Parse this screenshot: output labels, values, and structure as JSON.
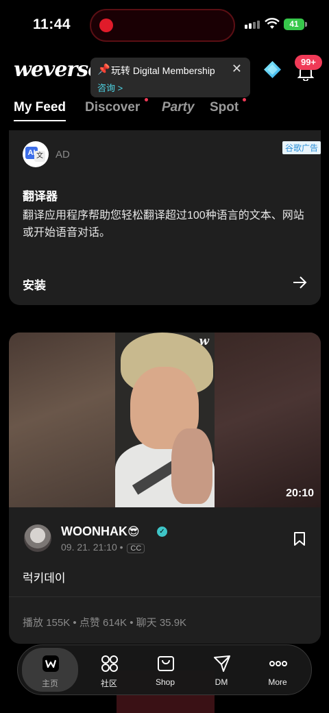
{
  "status_bar": {
    "time": "11:44",
    "battery": "41"
  },
  "header": {
    "logo": "weverse",
    "popup": {
      "text": "玩转 Digital Membership",
      "link": "咨询 >"
    },
    "notification_badge": "99+"
  },
  "tabs": [
    {
      "label": "My Feed"
    },
    {
      "label": "Discover"
    },
    {
      "label": "Party"
    },
    {
      "label": "Spot"
    }
  ],
  "ad": {
    "label": "AD",
    "google_tag": "谷歌广告",
    "icon_text_a": "AI",
    "icon_text_b": "文",
    "title": "翻译器",
    "description": "翻译应用程序帮助您轻松翻译超过100种语言的文本、网站或开始语音对话。",
    "install": "安装"
  },
  "post": {
    "duration": "20:10",
    "watermark": "w",
    "author": "WOONHAK",
    "author_emoji": "😎",
    "date": "09. 21. 21:10 •",
    "cc": "CC",
    "text": "럭키데이",
    "stats": {
      "plays_label": "播放",
      "plays": "155K",
      "likes_label": "点赞",
      "likes": "614K",
      "chats_label": "聊天",
      "chats": "35.9K"
    }
  },
  "nav": [
    {
      "label": "主页"
    },
    {
      "label": "社区"
    },
    {
      "label": "Shop"
    },
    {
      "label": "DM"
    },
    {
      "label": "More"
    }
  ],
  "colors": {
    "accent": "#f03a57",
    "teal": "#3ec5c7",
    "background": "#000000",
    "card": "#1f1f1f"
  }
}
